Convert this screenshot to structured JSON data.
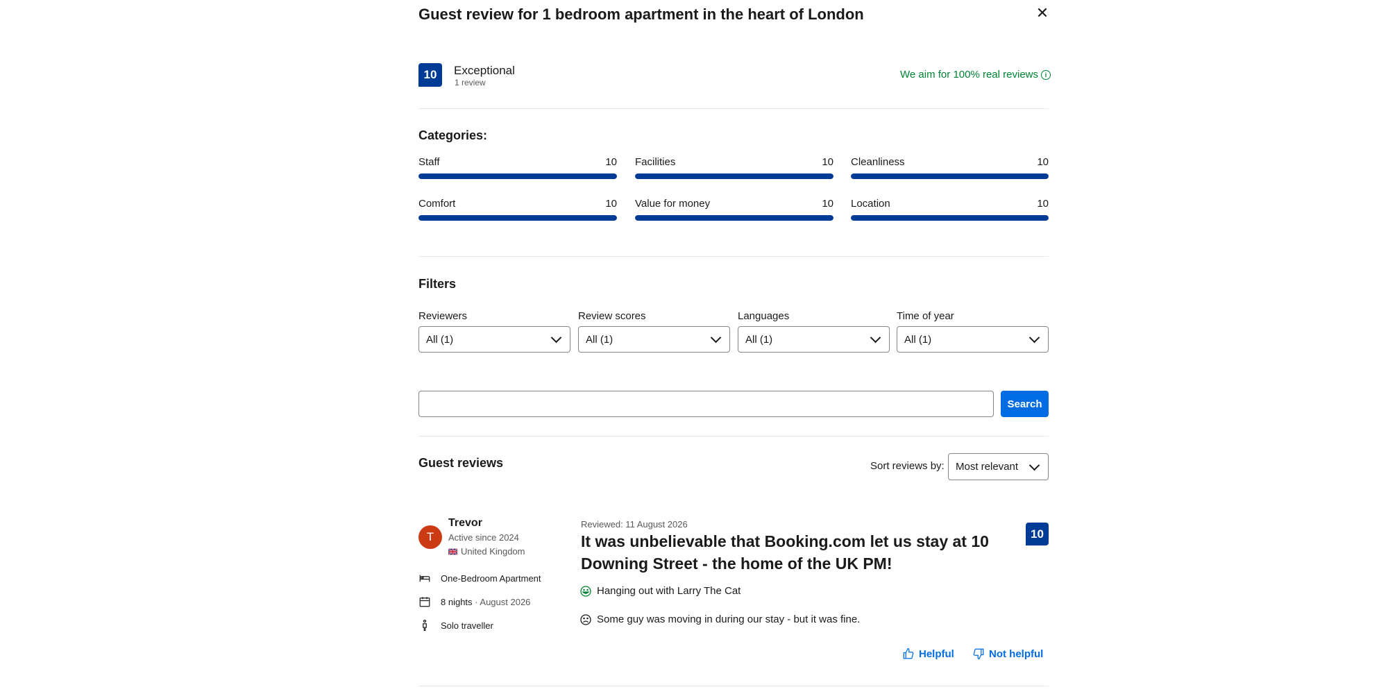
{
  "dialog": {
    "title": "Guest review for 1 bedroom apartment in the heart of London",
    "close_icon": "close-icon"
  },
  "overall": {
    "score": "10",
    "label": "Exceptional",
    "count": "1 review",
    "real_reviews": "We aim for 100% real reviews",
    "real_icon": "info-icon"
  },
  "categories": {
    "heading": "Categories:",
    "items": [
      {
        "name": "Staff",
        "score": "10",
        "fraction": 1.0
      },
      {
        "name": "Facilities",
        "score": "10",
        "fraction": 1.0
      },
      {
        "name": "Cleanliness",
        "score": "10",
        "fraction": 1.0
      },
      {
        "name": "Comfort",
        "score": "10",
        "fraction": 1.0
      },
      {
        "name": "Value for money",
        "score": "10",
        "fraction": 1.0
      },
      {
        "name": "Location",
        "score": "10",
        "fraction": 1.0
      }
    ]
  },
  "filters": {
    "heading": "Filters",
    "items": [
      {
        "label": "Reviewers",
        "value": "All (1)"
      },
      {
        "label": "Review scores",
        "value": "All (1)"
      },
      {
        "label": "Languages",
        "value": "All (1)"
      },
      {
        "label": "Time of year",
        "value": "All (1)"
      }
    ]
  },
  "search": {
    "value": "",
    "placeholder": "",
    "button": "Search"
  },
  "guest_reviews": {
    "heading": "Guest reviews",
    "sort_label": "Sort reviews by:",
    "sort_value": "Most relevant"
  },
  "review": {
    "avatar_letter": "T",
    "name": "Trevor",
    "since": "Active since 2024",
    "country": "United Kingdom",
    "room": "One-Bedroom Apartment",
    "nights": "8 nights",
    "stay_date": "· August 2026",
    "traveller": "Solo traveller",
    "reviewed": "Reviewed: 11 August 2026",
    "headline": "It was unbelievable that Booking.com let us stay at 10 Downing Street - the home of the UK PM!",
    "score": "10",
    "positive": "Hanging out with Larry The Cat",
    "negative": "Some guy was moving in during our stay - but it was fine.",
    "helpful": "Helpful",
    "not_helpful": "Not helpful"
  },
  "colors": {
    "brand": "#003b95",
    "accent": "#006ce4",
    "positive": "#008234",
    "avatar": "#cc3a14"
  }
}
